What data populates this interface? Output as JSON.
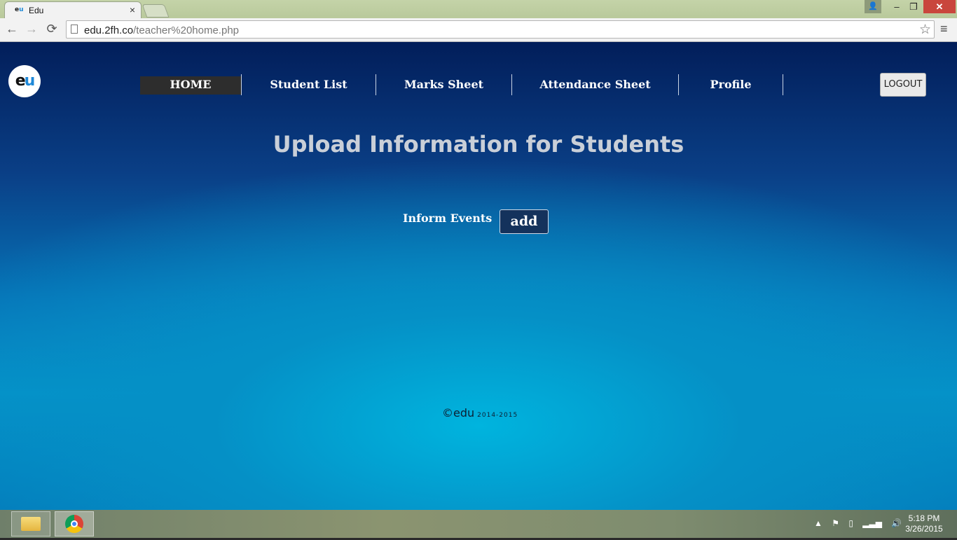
{
  "browser": {
    "tab_title": "Edu",
    "tab_favicon_left": "e",
    "tab_favicon_right": "u",
    "tab_close_icon": "×",
    "url_host": "edu.2fh.co",
    "url_path": "/teacher%20home.php",
    "back_icon": "←",
    "forward_icon": "→",
    "reload_icon": "⟳",
    "star_icon": "☆",
    "menu_icon": "≡",
    "window_user_icon": "👤",
    "minimize_icon": "–",
    "maximize_icon": "❐",
    "close_icon": "✕"
  },
  "site": {
    "logo_left": "e",
    "logo_right": "u",
    "nav": {
      "home": "HOME",
      "student_list": "Student List",
      "marks_sheet": "Marks Sheet",
      "attendance_sheet": "Attendance Sheet",
      "profile": "Profile"
    },
    "logout_label": "LOGOUT",
    "heading": "Upload Information for Students",
    "inform_label": "Inform Events",
    "add_label": "add",
    "footer_brand": "©edu",
    "footer_years": "2014-2015"
  },
  "taskbar": {
    "tray_up_icon": "▲",
    "tray_flag_icon": "⚑",
    "tray_battery_icon": "▯",
    "tray_signal_icon": "▂▃▅",
    "tray_volume_icon": "🔊",
    "time": "5:18 PM",
    "date": "3/26/2015"
  }
}
